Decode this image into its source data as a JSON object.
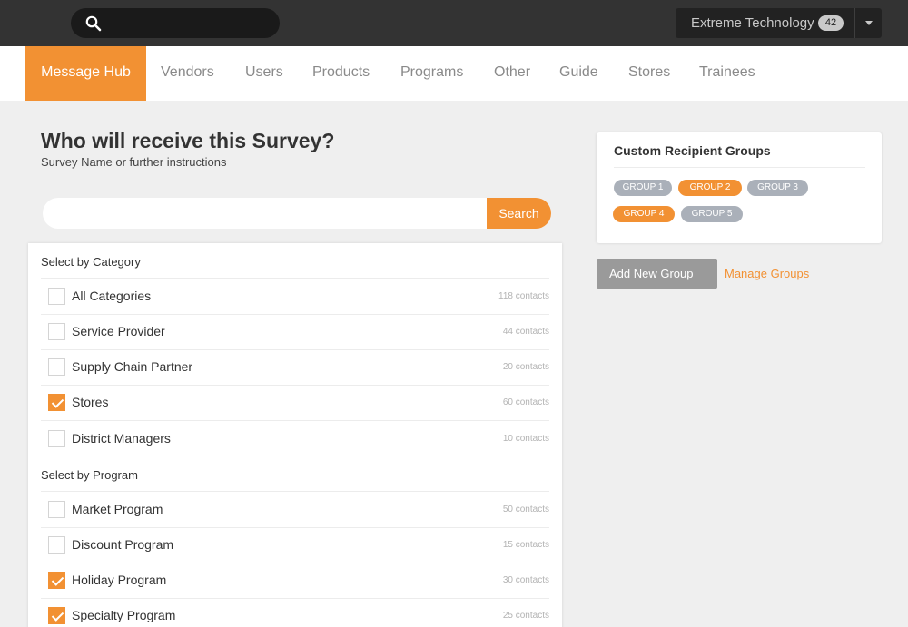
{
  "topbar": {
    "search_placeholder": "",
    "account_name": "Extreme Technology",
    "account_badge": "42"
  },
  "nav": {
    "items": [
      {
        "label": "Message Hub",
        "active": true
      },
      {
        "label": "Vendors"
      },
      {
        "label": "Users"
      },
      {
        "label": "Products"
      },
      {
        "label": "Programs"
      },
      {
        "label": "Other"
      },
      {
        "label": "Guide"
      },
      {
        "label": "Stores"
      },
      {
        "label": "Trainees"
      }
    ]
  },
  "page": {
    "title": "Who will receive this Survey?",
    "subtitle": "Survey Name or further instructions"
  },
  "search": {
    "placeholder": "",
    "button_label": "Search"
  },
  "category_section": {
    "heading": "Select by Category",
    "items": [
      {
        "label": "All Categories",
        "count": "118 contacts",
        "checked": false
      },
      {
        "label": "Service Provider",
        "count": "44 contacts",
        "checked": false
      },
      {
        "label": "Supply Chain Partner",
        "count": "20 contacts",
        "checked": false
      },
      {
        "label": "Stores",
        "count": "60 contacts",
        "checked": true
      },
      {
        "label": "District Managers",
        "count": "10 contacts",
        "checked": false
      }
    ]
  },
  "program_section": {
    "heading": "Select by Program",
    "items": [
      {
        "label": "Market Program",
        "count": "50 contacts",
        "checked": false
      },
      {
        "label": "Discount Program",
        "count": "15 contacts",
        "checked": false
      },
      {
        "label": "Holiday Program",
        "count": "30 contacts",
        "checked": true
      },
      {
        "label": "Specialty Program",
        "count": "25 contacts",
        "checked": true
      }
    ]
  },
  "groups": {
    "title": "Custom Recipient Groups",
    "tags": [
      {
        "label": "GROUP 1",
        "selected": false
      },
      {
        "label": "GROUP 2",
        "selected": true
      },
      {
        "label": "GROUP 3",
        "selected": false
      },
      {
        "label": "GROUP 4",
        "selected": true
      },
      {
        "label": "GROUP 5",
        "selected": false
      }
    ],
    "add_button": "Add New Group",
    "manage_link": "Manage Groups"
  },
  "colors": {
    "accent": "#f29133",
    "topbar": "#333333",
    "tag_grey": "#aab0b9"
  }
}
